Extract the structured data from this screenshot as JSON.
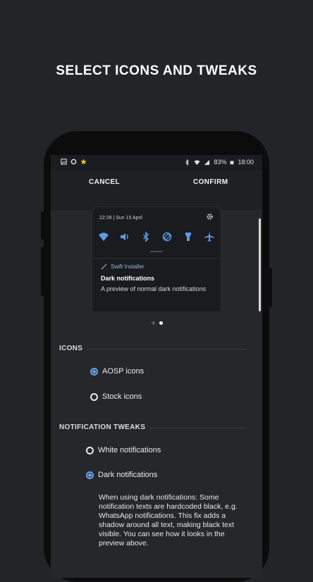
{
  "headline": "SELECT ICONS AND TWEAKS",
  "status_bar": {
    "battery": "83%",
    "time": "18:00",
    "icons": [
      "gallery-icon",
      "settings-icon",
      "star-icon",
      "bluetooth-icon",
      "wifi-icon",
      "signal-icon",
      "battery-icon"
    ]
  },
  "toolbar": {
    "cancel_label": "CANCEL",
    "confirm_label": "CONFIRM"
  },
  "preview": {
    "time_date": "22:28 | Sun 15 April",
    "quick_settings": [
      "wifi-icon",
      "volume-icon",
      "bluetooth-icon",
      "rotate-icon",
      "flashlight-icon",
      "airplane-icon"
    ],
    "app_name": "Swift Installer",
    "notification_title": "Dark notifications",
    "notification_text": "A preview of normal dark notifications",
    "pages": 2,
    "active_page": 2
  },
  "icons_section": {
    "title": "ICONS",
    "options": [
      {
        "label": "AOSP icons",
        "selected": true
      },
      {
        "label": "Stock icons",
        "selected": false
      }
    ]
  },
  "notification_section": {
    "title": "NOTIFICATION TWEAKS",
    "options": [
      {
        "label": "White notifications",
        "selected": false
      },
      {
        "label": "Dark notifications",
        "selected": true
      }
    ],
    "description": "When using dark notifications: Some notification texts are hardcoded black, e.g. WhatsApp notifications. This fix adds a shadow around all text, making black text visible. You can see how it looks in the preview above."
  },
  "colors": {
    "accent": "#6fa3ea",
    "background": "#232428",
    "screen": "#26272b"
  }
}
